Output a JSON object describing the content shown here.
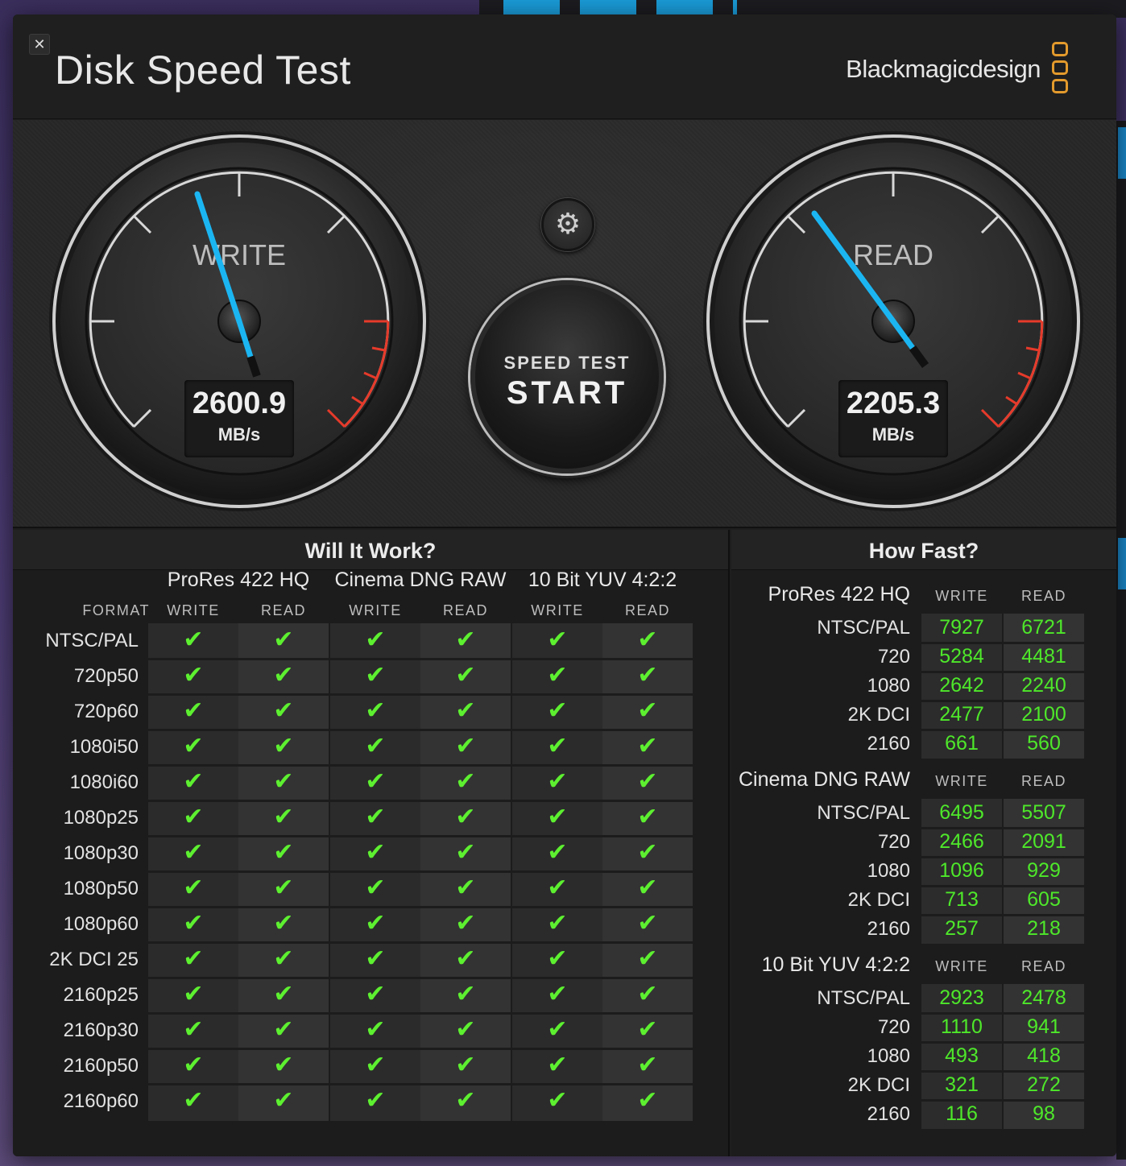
{
  "app": {
    "title": "Disk Speed Test",
    "brand": "Blackmagicdesign",
    "close_label": "✕",
    "brand_color": "#e39a2c"
  },
  "gauges": {
    "write": {
      "label": "WRITE",
      "value": "2600.9",
      "unit": "MB/s"
    },
    "read": {
      "label": "READ",
      "value": "2205.3",
      "unit": "MB/s"
    },
    "needle_color": "#1bb6f2",
    "redline_color": "#e63a2a"
  },
  "controls": {
    "settings_icon": "gear-icon",
    "start_small": "SPEED TEST",
    "start_big": "START"
  },
  "will_it_work": {
    "title": "Will It Work?",
    "format_header": "FORMAT",
    "codecs": [
      "ProRes 422 HQ",
      "Cinema DNG RAW",
      "10 Bit YUV 4:2:2"
    ],
    "write_label": "WRITE",
    "read_label": "READ",
    "check_glyph": "✔",
    "check_color": "#5df030",
    "formats": [
      "NTSC/PAL",
      "720p50",
      "720p60",
      "1080i50",
      "1080i60",
      "1080p25",
      "1080p30",
      "1080p50",
      "1080p60",
      "2K DCI 25",
      "2160p25",
      "2160p30",
      "2160p50",
      "2160p60"
    ]
  },
  "how_fast": {
    "title": "How Fast?",
    "write_label": "WRITE",
    "read_label": "READ",
    "value_color": "#4ee82a",
    "groups": [
      {
        "name": "ProRes 422 HQ",
        "rows": [
          {
            "label": "NTSC/PAL",
            "write": "7927",
            "read": "6721"
          },
          {
            "label": "720",
            "write": "5284",
            "read": "4481"
          },
          {
            "label": "1080",
            "write": "2642",
            "read": "2240"
          },
          {
            "label": "2K DCI",
            "write": "2477",
            "read": "2100"
          },
          {
            "label": "2160",
            "write": "661",
            "read": "560"
          }
        ]
      },
      {
        "name": "Cinema DNG RAW",
        "rows": [
          {
            "label": "NTSC/PAL",
            "write": "6495",
            "read": "5507"
          },
          {
            "label": "720",
            "write": "2466",
            "read": "2091"
          },
          {
            "label": "1080",
            "write": "1096",
            "read": "929"
          },
          {
            "label": "2K DCI",
            "write": "713",
            "read": "605"
          },
          {
            "label": "2160",
            "write": "257",
            "read": "218"
          }
        ]
      },
      {
        "name": "10 Bit YUV 4:2:2",
        "rows": [
          {
            "label": "NTSC/PAL",
            "write": "2923",
            "read": "2478"
          },
          {
            "label": "720",
            "write": "1110",
            "read": "941"
          },
          {
            "label": "1080",
            "write": "493",
            "read": "418"
          },
          {
            "label": "2K DCI",
            "write": "321",
            "read": "272"
          },
          {
            "label": "2160",
            "write": "116",
            "read": "98"
          }
        ]
      }
    ]
  }
}
